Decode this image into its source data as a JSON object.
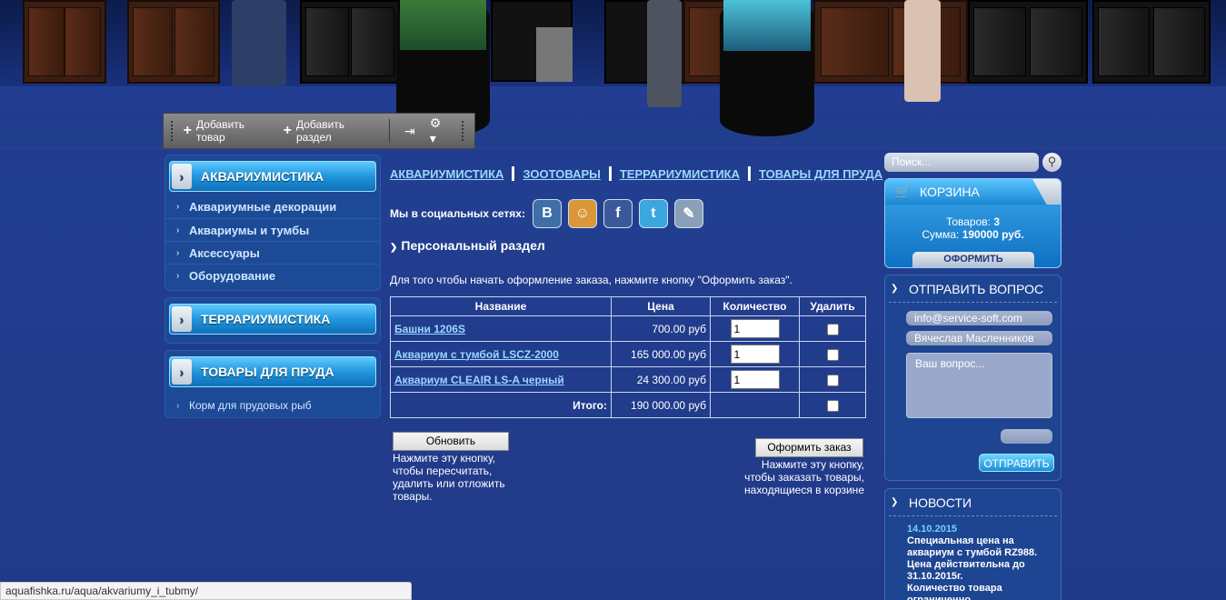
{
  "admin_toolbar": {
    "add_item": "Добавить товар",
    "add_section": "Добавить раздел"
  },
  "sidebar": {
    "boxes": [
      {
        "title": "АКВАРИУМИСТИКА",
        "items": [
          "Аквариумные декорации",
          "Аквариумы и тумбы",
          "Аксессуары",
          "Оборудование"
        ]
      },
      {
        "title": "ТЕРРАРИУМИСТИКА",
        "items": []
      },
      {
        "title": "ТОВАРЫ ДЛЯ ПРУДА",
        "items": [
          "Корм для прудовых рыб"
        ]
      }
    ]
  },
  "topnav": [
    "АКВАРИУМИСТИКА",
    "ЗООТОВАРЫ",
    "ТЕРРАРИУМИСТИКА",
    "ТОВАРЫ ДЛЯ ПРУДА"
  ],
  "social": {
    "label": "Мы в социальных сетях:",
    "icons": [
      {
        "name": "vk-icon",
        "glyph": "В",
        "color": "#3f6ea8"
      },
      {
        "name": "odnoklassniki-icon",
        "glyph": "☺",
        "color": "#e9a23a"
      },
      {
        "name": "facebook-icon",
        "glyph": "f",
        "color": "#3b5998"
      },
      {
        "name": "twitter-icon",
        "glyph": "t",
        "color": "#3aa7dd"
      },
      {
        "name": "livejournal-icon",
        "glyph": "✎",
        "color": "#8aa0b8"
      }
    ]
  },
  "page": {
    "section_title": "Персональный раздел",
    "intro": "Для того чтобы начать оформление заказа, нажмите кнопку \"Оформить заказ\"."
  },
  "cart_table": {
    "headers": [
      "Название",
      "Цена",
      "Количество",
      "Удалить"
    ],
    "rows": [
      {
        "name": "Башни 1206S",
        "price": "700.00 руб",
        "qty": "1"
      },
      {
        "name": "Аквариум с тумбой LSCZ-2000",
        "price": "165 000.00 руб",
        "qty": "1"
      },
      {
        "name": "Аквариум CLEAIR LS-A черный",
        "price": "24 300.00 руб",
        "qty": "1"
      }
    ],
    "total_label": "Итого:",
    "total_value": "190 000.00 руб"
  },
  "actions": {
    "update_label": "Обновить",
    "update_note": "Нажмите эту кнопку, чтобы пересчитать, удалить или отложить товары.",
    "order_label": "Оформить заказ",
    "order_note": "Нажмите эту кнопку, чтобы заказать товары, находящиеся в корзине"
  },
  "search": {
    "placeholder": "Поиск..."
  },
  "cart_box": {
    "title": "КОРЗИНА",
    "items_label": "Товаров:",
    "items_count": "3",
    "sum_label": "Сумма:",
    "sum_value": "190000 руб.",
    "order_button": "ОФОРМИТЬ"
  },
  "question_box": {
    "title": "ОТПРАВИТЬ ВОПРОС",
    "email": "info@service-soft.com",
    "name": "Вячеслав Масленников",
    "question_placeholder": "Ваш вопрос...",
    "send_button": "ОТПРАВИТЬ"
  },
  "news_box": {
    "title": "НОВОСТИ",
    "date": "14.10.2015",
    "text_1": "Специальная цена на аквариум с тумбой RZ988.",
    "text_2": "Цена действительна до 31.10.2015г.",
    "text_3": "Количество товара ограниченно."
  },
  "status_url": "aquafishka.ru/aqua/akvariumy_i_tubmy/"
}
